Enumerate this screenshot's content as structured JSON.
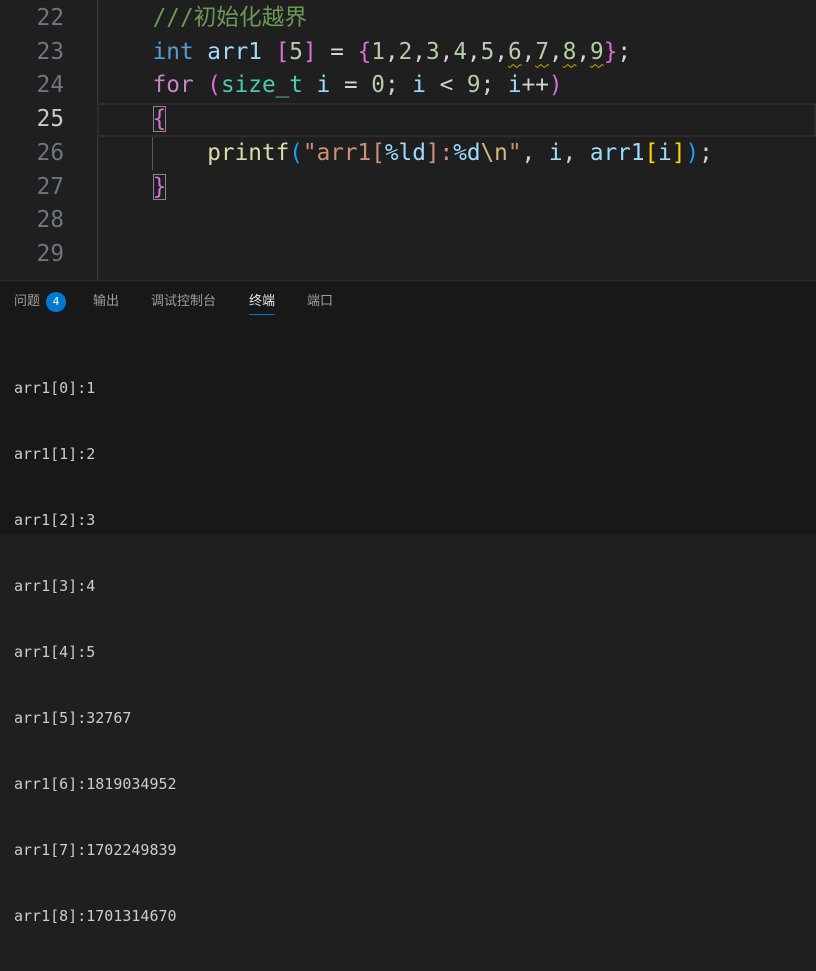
{
  "editor": {
    "lines": [
      {
        "number": "22",
        "tokens": [
          {
            "t": "    ///初始化越界",
            "color": "#6a9955"
          }
        ]
      },
      {
        "number": "23",
        "tokens": [
          {
            "t": "    int",
            "color": "#569cd6"
          },
          {
            "t": " ",
            "color": "#d4d4d4"
          },
          {
            "t": "arr1",
            "color": "#9cdcfe"
          },
          {
            "t": " ",
            "color": "#d4d4d4"
          },
          {
            "t": "[",
            "color": "#da70d6"
          },
          {
            "t": "5",
            "color": "#b5cea8"
          },
          {
            "t": "]",
            "color": "#da70d6"
          },
          {
            "t": " = ",
            "color": "#d4d4d4"
          },
          {
            "t": "{",
            "color": "#da70d6"
          },
          {
            "t": "1",
            "color": "#b5cea8"
          },
          {
            "t": ",",
            "color": "#d4d4d4"
          },
          {
            "t": "2",
            "color": "#b5cea8"
          },
          {
            "t": ",",
            "color": "#d4d4d4"
          },
          {
            "t": "3",
            "color": "#b5cea8"
          },
          {
            "t": ",",
            "color": "#d4d4d4"
          },
          {
            "t": "4",
            "color": "#b5cea8"
          },
          {
            "t": ",",
            "color": "#d4d4d4"
          },
          {
            "t": "5",
            "color": "#b5cea8"
          },
          {
            "t": ",",
            "color": "#d4d4d4"
          },
          {
            "t": "6",
            "color": "#b5cea8",
            "warn": true
          },
          {
            "t": ",",
            "color": "#d4d4d4"
          },
          {
            "t": "7",
            "color": "#b5cea8",
            "warn": true
          },
          {
            "t": ",",
            "color": "#d4d4d4"
          },
          {
            "t": "8",
            "color": "#b5cea8",
            "warn": true
          },
          {
            "t": ",",
            "color": "#d4d4d4"
          },
          {
            "t": "9",
            "color": "#b5cea8",
            "warn": true
          },
          {
            "t": "}",
            "color": "#da70d6"
          },
          {
            "t": ";",
            "color": "#d4d4d4"
          }
        ]
      },
      {
        "number": "24",
        "tokens": [
          {
            "t": "    for",
            "color": "#c586c0"
          },
          {
            "t": " ",
            "color": "#d4d4d4"
          },
          {
            "t": "(",
            "color": "#da70d6"
          },
          {
            "t": "size_t",
            "color": "#4ec9b0"
          },
          {
            "t": " ",
            "color": "#d4d4d4"
          },
          {
            "t": "i",
            "color": "#9cdcfe"
          },
          {
            "t": " = ",
            "color": "#d4d4d4"
          },
          {
            "t": "0",
            "color": "#b5cea8"
          },
          {
            "t": "; ",
            "color": "#d4d4d4"
          },
          {
            "t": "i",
            "color": "#9cdcfe"
          },
          {
            "t": " < ",
            "color": "#d4d4d4"
          },
          {
            "t": "9",
            "color": "#b5cea8"
          },
          {
            "t": "; ",
            "color": "#d4d4d4"
          },
          {
            "t": "i",
            "color": "#9cdcfe"
          },
          {
            "t": "++",
            "color": "#d4d4d4"
          },
          {
            "t": ")",
            "color": "#da70d6"
          }
        ]
      },
      {
        "number": "25",
        "current": true,
        "tokens": [
          {
            "t": "    ",
            "color": "#d4d4d4"
          },
          {
            "t": "{",
            "color": "#da70d6",
            "match": true
          }
        ]
      },
      {
        "number": "26",
        "tokens": [
          {
            "t": "        printf",
            "color": "#dcdcaa"
          },
          {
            "t": "(",
            "color": "#179fff"
          },
          {
            "t": "\"arr1[",
            "color": "#ce9178"
          },
          {
            "t": "%ld",
            "color": "#9cdcfe"
          },
          {
            "t": "]:",
            "color": "#ce9178"
          },
          {
            "t": "%d",
            "color": "#9cdcfe"
          },
          {
            "t": "\\n",
            "color": "#d7ba7d"
          },
          {
            "t": "\"",
            "color": "#ce9178"
          },
          {
            "t": ", ",
            "color": "#d4d4d4"
          },
          {
            "t": "i",
            "color": "#9cdcfe"
          },
          {
            "t": ", ",
            "color": "#d4d4d4"
          },
          {
            "t": "arr1",
            "color": "#9cdcfe"
          },
          {
            "t": "[",
            "color": "#ffd700"
          },
          {
            "t": "i",
            "color": "#9cdcfe"
          },
          {
            "t": "]",
            "color": "#ffd700"
          },
          {
            "t": ")",
            "color": "#179fff"
          },
          {
            "t": ";",
            "color": "#d4d4d4"
          }
        ]
      },
      {
        "number": "27",
        "tokens": [
          {
            "t": "    ",
            "color": "#d4d4d4"
          },
          {
            "t": "}",
            "color": "#da70d6",
            "match": true
          }
        ]
      },
      {
        "number": "28",
        "tokens": []
      },
      {
        "number": "29",
        "tokens": []
      }
    ]
  },
  "panel": {
    "tabs": [
      {
        "label": "问题",
        "badge": "4"
      },
      {
        "label": "输出"
      },
      {
        "label": "调试控制台"
      },
      {
        "label": "终端",
        "active": true
      },
      {
        "label": "端口"
      }
    ],
    "accent_color": "#0078d4",
    "terminal_lines": [
      "arr1[0]:1",
      "arr1[1]:2",
      "arr1[2]:3",
      "arr1[3]:4",
      "arr1[4]:5",
      "arr1[5]:32767",
      "arr1[6]:1819034952",
      "arr1[7]:1702249839",
      "arr1[8]:1701314670"
    ]
  }
}
